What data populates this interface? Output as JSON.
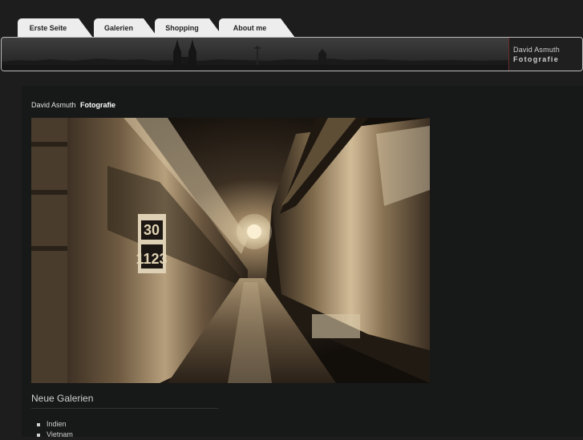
{
  "nav": {
    "tabs": [
      {
        "label": "Erste Seite"
      },
      {
        "label": "Galerien"
      },
      {
        "label": "Shopping"
      },
      {
        "label": "About me"
      }
    ]
  },
  "banner": {
    "name": "David Asmuth",
    "subtitle": "Fotografie"
  },
  "main": {
    "site_title_name": "David Asmuth",
    "site_title_bold": "Fotografie",
    "photo": {
      "numbers": [
        "30",
        "1123"
      ]
    },
    "section_title": "Neue Galerien",
    "galleries": [
      "Indien",
      "Vietnam"
    ]
  }
}
